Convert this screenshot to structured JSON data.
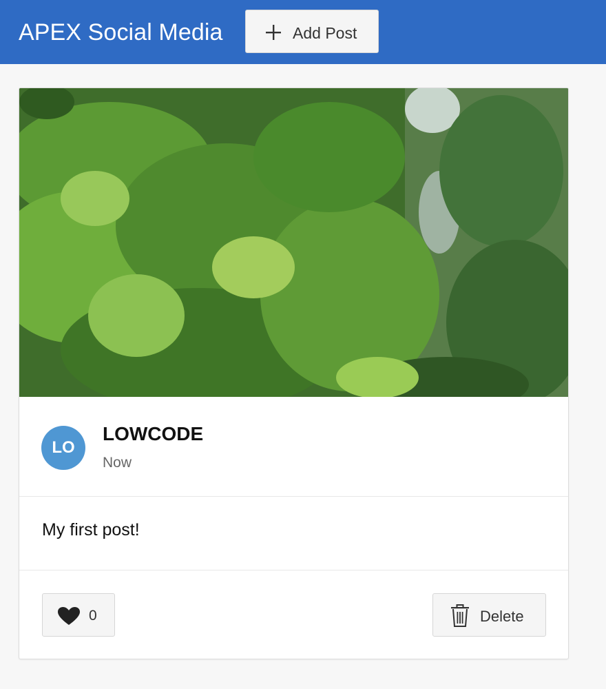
{
  "header": {
    "title": "APEX Social Media",
    "add_post_label": "Add Post",
    "add_post_icon": "plus-icon",
    "background_color": "#2f6bc4"
  },
  "post": {
    "image_description_icon": "post-photo-trees",
    "avatar_initials": "LO",
    "avatar_color": "#4f97d3",
    "author": "LOWCODE",
    "time": "Now",
    "text": "My first post!",
    "likes": "0",
    "like_icon": "heart-icon",
    "delete_label": "Delete",
    "delete_icon": "trash-icon"
  }
}
